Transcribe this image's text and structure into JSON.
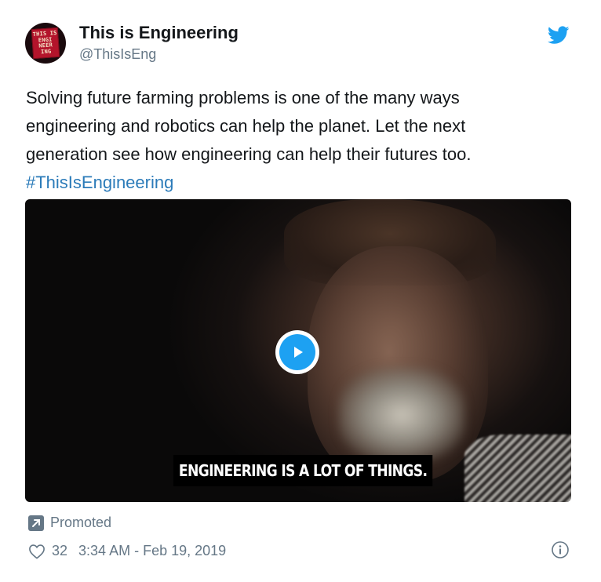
{
  "account": {
    "name": "This is Engineering",
    "handle": "@ThisIsEng",
    "avatar_text": [
      "THIS IS",
      "ENGI",
      "NEER",
      "ING"
    ]
  },
  "tweet": {
    "text_lines": [
      "Solving future farming problems is one of the many ways",
      "engineering and robotics can help the planet. Let the next",
      "generation see how engineering can help their futures too."
    ],
    "hashtag": "#ThisIsEngineering"
  },
  "media": {
    "caption": "ENGINEERING IS A LOT OF THINGS.",
    "play_icon": "play-icon"
  },
  "footer": {
    "promoted_label": "Promoted",
    "like_count": "32",
    "timestamp": "3:34 AM - Feb 19, 2019"
  },
  "colors": {
    "twitter_blue": "#1da1f2",
    "link_blue": "#2b7bb9",
    "secondary_text": "#657786",
    "primary_text": "#14171a"
  },
  "icons": {
    "brand": "twitter-bird-icon",
    "promoted": "promoted-arrow-icon",
    "like": "heart-icon",
    "info": "info-icon"
  }
}
